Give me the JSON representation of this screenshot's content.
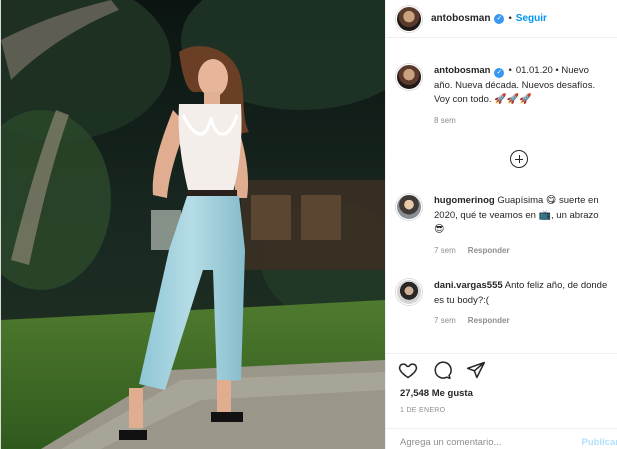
{
  "post": {
    "username": "antobosman",
    "follow_label": "Seguir",
    "dot": "•"
  },
  "caption": {
    "username": "antobosman",
    "text_1": "01.01.20 • Nuevo año. Nueva década. Nuevos desafíos. Voy con todo.",
    "rockets": "🚀🚀🚀",
    "time": "8 sem"
  },
  "comments": [
    {
      "username": "hugomerinog",
      "text_1": "Guapísima",
      "emoji_1": "😋",
      "text_2": "suerte en 2020, qué te veamos en",
      "emoji_2": "📺",
      "text_3": ", un abrazo",
      "emoji_3": "😎",
      "time": "7 sem",
      "reply_label": "Responder"
    },
    {
      "username": "dani.vargas555",
      "text": "Anto feliz año, de donde es tu body?:(",
      "time": "7 sem",
      "reply_label": "Responder"
    }
  ],
  "actions": {
    "likes": "27,548 Me gusta",
    "date": "1 DE ENERO"
  },
  "add_comment": {
    "placeholder": "Agrega un comentario...",
    "publish_label": "Publicar"
  },
  "colors": {
    "link": "#0095f6",
    "verified": "#3897f0",
    "muted": "#8e8e8e"
  }
}
